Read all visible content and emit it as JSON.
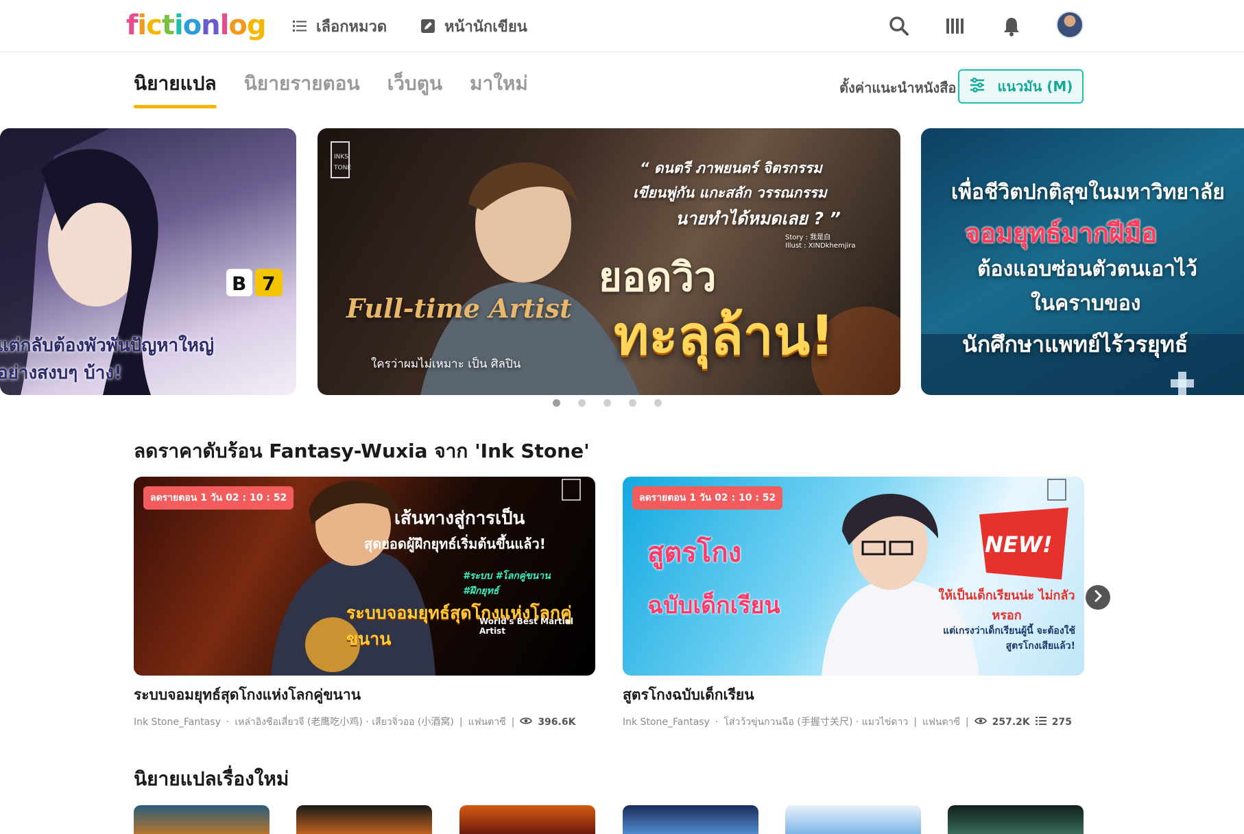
{
  "header": {
    "logo_text": "fictionlog",
    "nav": [
      {
        "label": "เลือกหมวด",
        "icon": "list-icon"
      },
      {
        "label": "หน้านักเขียน",
        "icon": "pen-icon"
      }
    ],
    "icons": [
      "search-icon",
      "library-icon",
      "bell-icon",
      "avatar"
    ]
  },
  "tabs": {
    "items": [
      "นิยายแปล",
      "นิยายรายตอน",
      "เว็บตูน",
      "มาใหม่"
    ],
    "active": "นิยายแปล"
  },
  "preference": {
    "label": "ตั้งค่าแนะนำหนังสือ",
    "button_label": "แนวมัน (M)"
  },
  "banners": [
    {
      "caption_1": "แต่กลับต้องพัวพันปัญหาใหญ่",
      "caption_2": "อย่างสงบๆ บ้าง!"
    },
    {
      "caption_1": "“ ดนตรี ภาพยนตร์ จิตรกรรม",
      "caption_2": "เขียนพู่กัน แกะสลัก วรรณกรรม",
      "caption_3": "นายทำได้หมดเลย ? ”",
      "headline_1": "ยอดวิว",
      "headline_2": "ทะลุล้าน!",
      "logo": "Full-time Artist",
      "sub": "ใครว่าผมไม่เหมาะ เป็น ศิลปิน",
      "credit_1": "Story : 我是白",
      "credit_2": "Illust : XINDkhemjira"
    },
    {
      "caption_1": "เพื่อชีวิตปกติสุขในมหาวิทยาลัย",
      "caption_2": "จอมยุทธ์มากฝีมือ",
      "caption_3": "ต้องแอบซ่อนตัวตนเอาไว้",
      "caption_4": "ในคราบของ",
      "caption_5": "นักศึกษาแพทย์ไร้วรยุทธ์"
    }
  ],
  "carousel": {
    "dot_count": 5,
    "active_index": 0
  },
  "sections": {
    "promo_title": "ลดราคาดับร้อน Fantasy-Wuxia จาก 'Ink Stone'",
    "new_title": "นิยายแปลเรื่องใหม่"
  },
  "featured": [
    {
      "badge": "ลดรายตอน 1 วัน 02 : 10 : 52",
      "title": "ระบบจอมยุทธ์สุดโกงแห่งโลกคู่ขนาน",
      "publisher": "Ink Stone_Fantasy",
      "authors": "เหล่าอิงชือเสี่ยวจี (老鹰吃小鸡) · เสียวจิ่วออ (小酒窝)",
      "genre": "แฟนตาซี",
      "views": "396.6K",
      "chapters": "",
      "art_text_1": "เส้นทางสู่การเป็น",
      "art_text_2": "สุดยอดผู้ฝึกยุทธ์เริ่มต้นขึ้นแล้ว!",
      "art_text_3": "#ระบบ #โลกคู่ขนาน #ฝึกยุทธ์",
      "art_text_4": "ระบบจอมยุทธ์สุดโกงแห่งโลกคู่ขนาน",
      "art_text_5": "World's Best Martial Artist"
    },
    {
      "badge": "ลดรายตอน 1 วัน 02 : 10 : 52",
      "title": "สูตรโกงฉบับเด็กเรียน",
      "publisher": "Ink Stone_Fantasy",
      "authors": "โส่วว้วขุ่นกวนฉือ (手握寸关尺) · แมวไข่ดาว",
      "genre": "แฟนตาซี",
      "views": "257.2K",
      "chapters": "275",
      "art_text_1": "สูตรโกง",
      "art_text_2": "ฉบับเด็กเรียน",
      "art_text_3": "NEW!",
      "art_text_4": "ให้เป็นเด็กเรียนน่ะ ไม่กลัวหรอก",
      "art_text_5": "แต่เกรงว่าเด็กเรียนผู้นี้ จะต้องใช้สูตรโกงเสียแล้ว!"
    }
  ],
  "thumbnails": [
    {
      "icon": "book-cover-icon"
    },
    {
      "icon": "book-cover-icon"
    },
    {
      "icon": "book-cover-icon"
    },
    {
      "icon": "book-cover-icon"
    },
    {
      "icon": "book-cover-icon"
    },
    {
      "icon": "book-cover-icon"
    }
  ],
  "colors": {
    "accent_yellow": "#f7b500",
    "accent_teal": "#1fbfae",
    "badge_red": "#f25c5c"
  }
}
